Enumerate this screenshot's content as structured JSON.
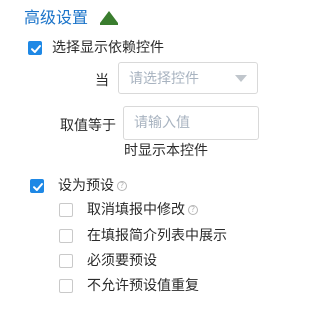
{
  "advanced": {
    "title": "高级设置",
    "toggle_icon": "collapse-triangle-icon",
    "toggle_color": "#3a7d2e"
  },
  "dependency": {
    "checkbox_label": "选择显示依赖控件",
    "checked": true,
    "when_label": "当",
    "control_select_placeholder": "请选择控件",
    "equals_label": "取值等于",
    "value_input_placeholder": "请输入值",
    "suffix_text": "时显示本控件"
  },
  "preset": {
    "checkbox_label": "设为预设",
    "checked": true,
    "help_icon": "?",
    "options": [
      {
        "label": "取消填报中修改",
        "checked": false,
        "has_help": true
      },
      {
        "label": "在填报简介列表中展示",
        "checked": false,
        "has_help": false
      },
      {
        "label": "必须要预设",
        "checked": false,
        "has_help": false
      },
      {
        "label": "不允许预设值重复",
        "checked": false,
        "has_help": false
      }
    ]
  },
  "colors": {
    "accent": "#1e88e5",
    "title": "#1a73c9",
    "placeholder": "#a8b3c0",
    "border": "#d9d9d9"
  }
}
